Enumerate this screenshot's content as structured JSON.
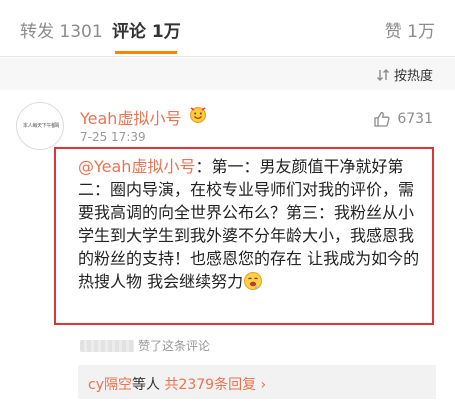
{
  "tabs": {
    "repost": "转发 1301",
    "comment": "评论 1万",
    "like": "赞 1万"
  },
  "sort": {
    "label": "按热度",
    "icon": "sort-icon"
  },
  "comment": {
    "avatar_text": "本人每天下午都睡觉",
    "user_name": "Yeah虚拟小号",
    "badge_icon": "vip-emoji-badge",
    "timestamp": "7-25 17:39",
    "like_count": "6731",
    "mention": "@Yeah虚拟小号",
    "body": "：第一：男友颜值干净就好第二：圈内导演，在校专业导师们对我的评价，需要我高调的向全世界公布么？第三：我粉丝从小学生到大学生到我外婆不分年龄大小，我感恩我的粉丝的支持！也感恩您的存在 让我成为如今的热搜人物 我会继续努力",
    "emoji_icon": "drooling-emoji",
    "liked_by_suffix": "赞了这条评论",
    "reply_user": "cy隔空",
    "reply_mid": "等人 ",
    "reply_count": "共2379条回复",
    "reply_arrow": " ›"
  },
  "colors": {
    "accent": "#ff8200",
    "username": "#eb7350",
    "highlight_border": "#e03434"
  }
}
